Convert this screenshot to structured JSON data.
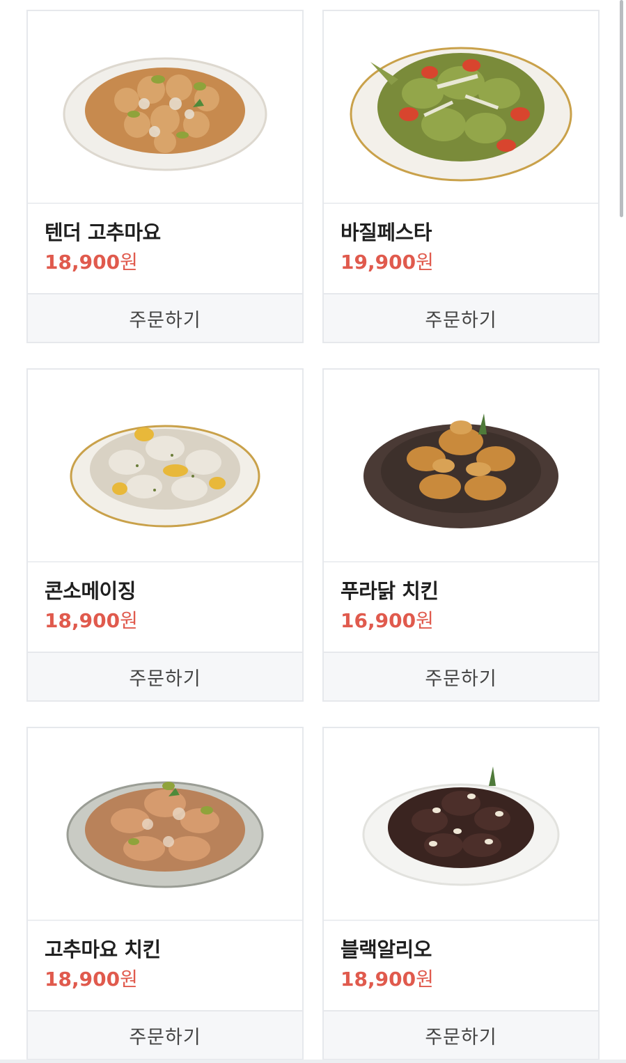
{
  "menu": {
    "order_label": "주문하기",
    "currency": "원",
    "items": [
      {
        "name": "텐더 고추마요",
        "price": "18,900",
        "image_icon": "tender-gochumayo-plate-image"
      },
      {
        "name": "바질페스타",
        "price": "19,900",
        "image_icon": "basil-pesta-plate-image"
      },
      {
        "name": "콘소메이징",
        "price": "18,900",
        "image_icon": "consommazing-plate-image"
      },
      {
        "name": "푸라닭 치킨",
        "price": "16,900",
        "image_icon": "puradak-chicken-plate-image"
      },
      {
        "name": "고추마요 치킨",
        "price": "18,900",
        "image_icon": "gochumayo-chicken-plate-image"
      },
      {
        "name": "블랙알리오",
        "price": "18,900",
        "image_icon": "black-alio-plate-image"
      }
    ]
  },
  "colors": {
    "price": "#e05a4d",
    "button_bg": "#f6f7f9",
    "border": "#e6e8ec"
  }
}
